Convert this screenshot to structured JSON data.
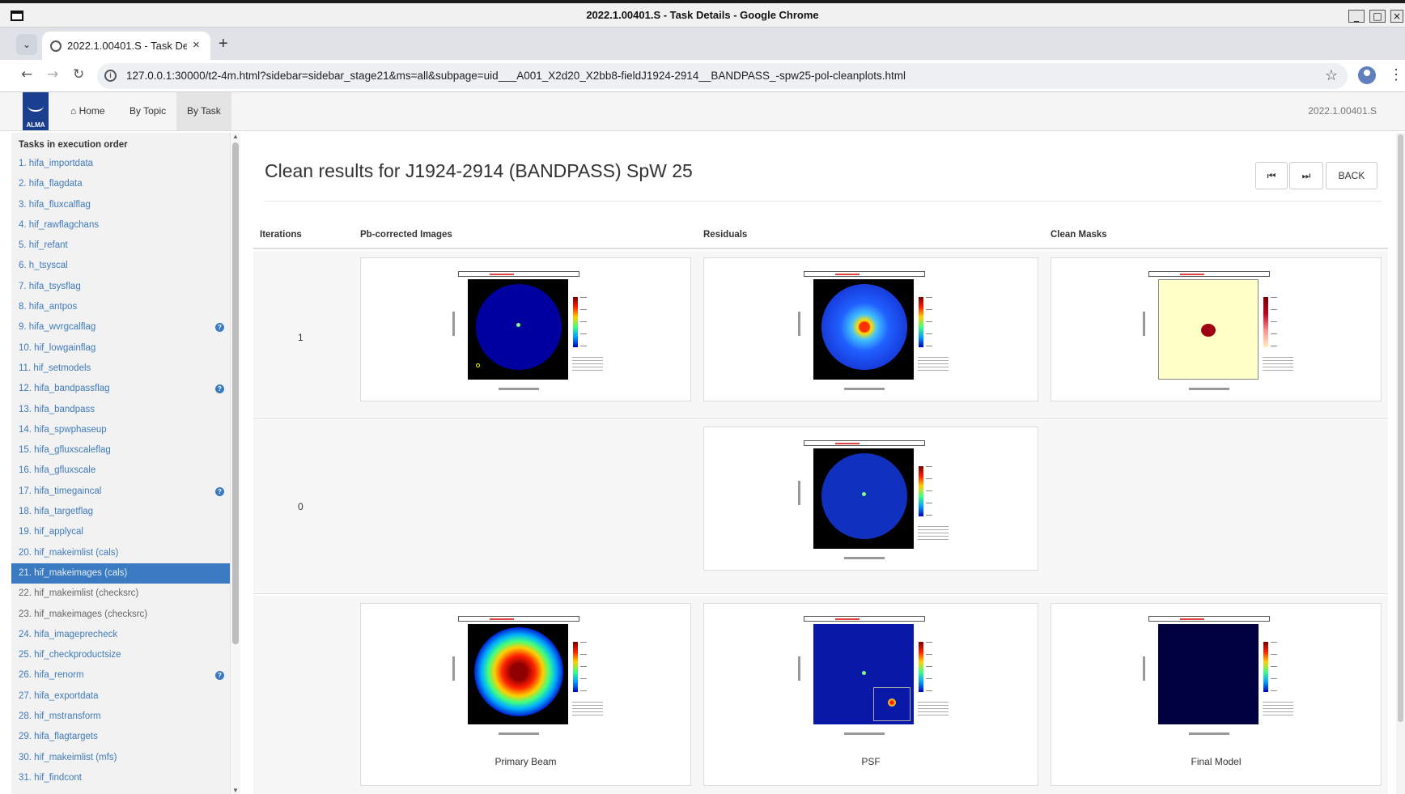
{
  "window": {
    "title": "2022.1.00401.S - Task Details - Google Chrome",
    "minimize_glyph": "_",
    "maximize_glyph": "□",
    "close_glyph": "×"
  },
  "browser": {
    "tab_title": "2022.1.00401.S - Task Details",
    "tab_close_glyph": "×",
    "new_tab_glyph": "+",
    "url": "127.0.0.1:30000/t2-4m.html?sidebar=sidebar_stage21&ms=all&subpage=uid___A001_X2d20_X2bb8-fieldJ1924-2914__BANDPASS_-spw25-pol-cleanplots.html",
    "icons": {
      "back": "back-arrow-icon",
      "forward": "forward-arrow-icon",
      "reload": "reload-icon",
      "bookmark": "star-icon",
      "profile": "profile-icon",
      "menu": "kebab-menu-icon"
    }
  },
  "header": {
    "logo_text": "ALMA",
    "nav": {
      "home": "Home",
      "by_topic": "By Topic",
      "by_task": "By Task"
    },
    "project_code": "2022.1.00401.S"
  },
  "sidebar": {
    "heading": "Tasks in execution order",
    "tasks": [
      {
        "label": "1. hifa_importdata",
        "warn": false
      },
      {
        "label": "2. hifa_flagdata",
        "warn": false
      },
      {
        "label": "3. hifa_fluxcalflag",
        "warn": false
      },
      {
        "label": "4. hif_rawflagchans",
        "warn": false
      },
      {
        "label": "5. hif_refant",
        "warn": false
      },
      {
        "label": "6. h_tsyscal",
        "warn": false
      },
      {
        "label": "7. hifa_tsysflag",
        "warn": false
      },
      {
        "label": "8. hifa_antpos",
        "warn": false
      },
      {
        "label": "9. hifa_wvrgcalflag",
        "warn": true
      },
      {
        "label": "10. hif_lowgainflag",
        "warn": false
      },
      {
        "label": "11. hif_setmodels",
        "warn": false
      },
      {
        "label": "12. hifa_bandpassflag",
        "warn": true
      },
      {
        "label": "13. hifa_bandpass",
        "warn": false
      },
      {
        "label": "14. hifa_spwphaseup",
        "warn": false
      },
      {
        "label": "15. hifa_gfluxscaleflag",
        "warn": false
      },
      {
        "label": "16. hifa_gfluxscale",
        "warn": false
      },
      {
        "label": "17. hifa_timegaincal",
        "warn": true
      },
      {
        "label": "18. hifa_targetflag",
        "warn": false
      },
      {
        "label": "19. hif_applycal",
        "warn": false
      },
      {
        "label": "20. hif_makeimlist (cals)",
        "warn": false
      },
      {
        "label": "21. hif_makeimages (cals)",
        "warn": false,
        "active": true
      },
      {
        "label": "22. hif_makeimlist (checksrc)",
        "warn": false,
        "muted": true
      },
      {
        "label": "23. hif_makeimages (checksrc)",
        "warn": false,
        "muted": true
      },
      {
        "label": "24. hifa_imageprecheck",
        "warn": false
      },
      {
        "label": "25. hif_checkproductsize",
        "warn": false
      },
      {
        "label": "26. hifa_renorm",
        "warn": true
      },
      {
        "label": "27. hifa_exportdata",
        "warn": false
      },
      {
        "label": "28. hif_mstransform",
        "warn": false
      },
      {
        "label": "29. hifa_flagtargets",
        "warn": false
      },
      {
        "label": "30. hif_makeimlist (mfs)",
        "warn": false
      },
      {
        "label": "31. hif_findcont",
        "warn": false
      }
    ]
  },
  "main": {
    "title": "Clean results for J1924-2914 (BANDPASS) SpW 25",
    "buttons": {
      "first": "⏮",
      "last": "⏭",
      "back": "BACK"
    },
    "columns": {
      "iterations": "Iterations",
      "pbcor": "Pb-corrected Images",
      "residuals": "Residuals",
      "clean_masks": "Clean Masks"
    },
    "rows": [
      {
        "iteration": "1"
      },
      {
        "iteration": "0"
      }
    ],
    "bottom_captions": {
      "primary_beam": "Primary Beam",
      "psf": "PSF",
      "final_model": "Final Model"
    }
  },
  "colors": {
    "accent": "#3a7ac0",
    "link": "#3f7ab8",
    "plot_background": "#000000",
    "plot_map_blue": "#0000a0",
    "mask_yellow": "#ffffc8"
  }
}
